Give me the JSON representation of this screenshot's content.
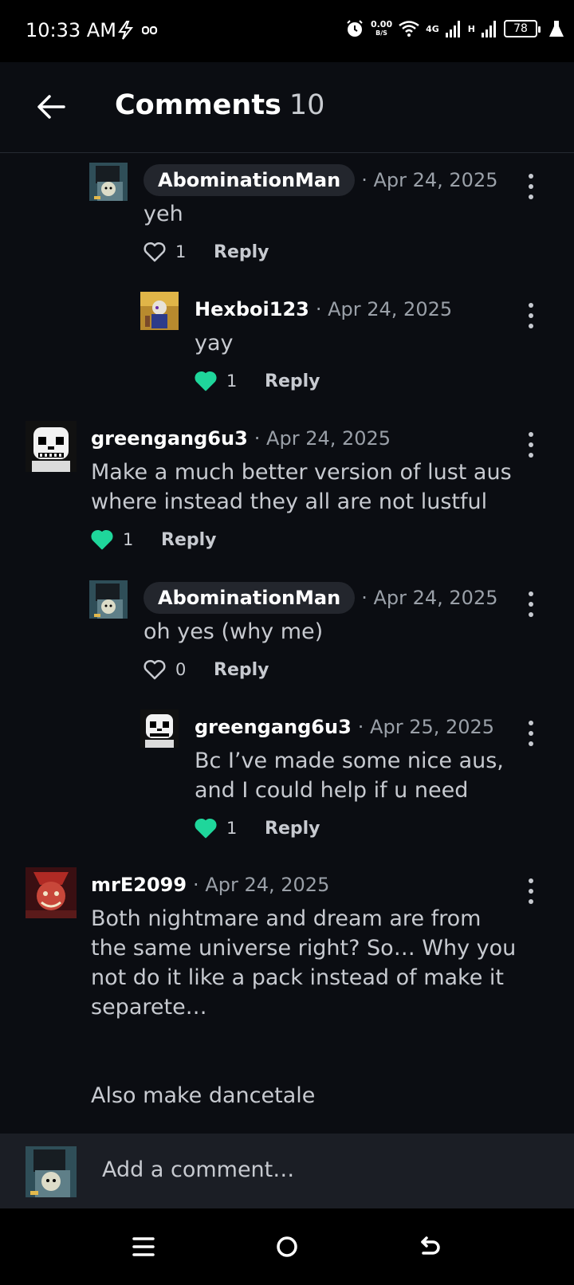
{
  "status_bar": {
    "time": "10:33 AM",
    "net_speed": "0.00",
    "net_unit": "B/S",
    "network_4g": "4G",
    "network_h": "H",
    "battery": "78"
  },
  "header": {
    "title": "Comments",
    "count": "10"
  },
  "comments": [
    {
      "username": "AbominationMan",
      "date": "Apr 24, 2025",
      "text": "yeh",
      "likes": "1",
      "liked": false,
      "reply_label": "Reply"
    },
    {
      "username": "Hexboi123",
      "date": "Apr 24, 2025",
      "text": "yay",
      "likes": "1",
      "liked": true,
      "reply_label": "Reply"
    },
    {
      "username": "greengang6u3",
      "date": "Apr 24, 2025",
      "text": "Make a much better version of lust aus where instead they all are not lustful",
      "likes": "1",
      "liked": true,
      "reply_label": "Reply"
    },
    {
      "username": "AbominationMan",
      "date": "Apr 24, 2025",
      "text": "oh yes (why me)",
      "likes": "0",
      "liked": false,
      "reply_label": "Reply"
    },
    {
      "username": "greengang6u3",
      "date": "Apr 25, 2025",
      "text": "Bc I’ve made some nice aus, and I could help if u need",
      "likes": "1",
      "liked": true,
      "reply_label": "Reply"
    },
    {
      "username": "mrE2099",
      "date": "Apr 24, 2025",
      "text": "Both nightmare and dream are from the same universe right? So… Why you not do it like a pack instead of make it separete…",
      "text_2": "Also make dancetale"
    }
  ],
  "composer": {
    "placeholder": "Add a comment…"
  },
  "colors": {
    "background": "#0b0d12",
    "liked": "#1fd69b",
    "text": "#c7cad0",
    "muted": "#9aa0a8"
  }
}
